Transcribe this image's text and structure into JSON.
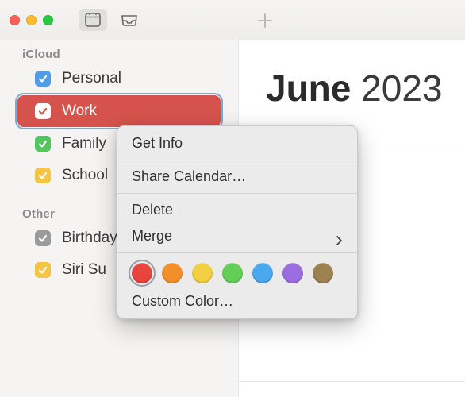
{
  "header": {
    "month": "June",
    "year": "2023"
  },
  "sidebar": {
    "sections": [
      {
        "title": "iCloud",
        "items": [
          {
            "label": "Personal",
            "color": "#4f9de6",
            "selected": false
          },
          {
            "label": "Work",
            "color": "#d5534c",
            "selected": true
          },
          {
            "label": "Family",
            "color": "#54c65e",
            "selected": false
          },
          {
            "label": "School",
            "color": "#f4c542",
            "selected": false
          }
        ]
      },
      {
        "title": "Other",
        "items": [
          {
            "label": "Birthdays",
            "color": "#9b9b9b",
            "selected": false
          },
          {
            "label": "Siri Su",
            "color": "#f4c542",
            "selected": false
          }
        ]
      }
    ]
  },
  "context_menu": {
    "get_info": "Get Info",
    "share": "Share Calendar…",
    "delete": "Delete",
    "merge": "Merge",
    "custom_color": "Custom Color…",
    "colors": [
      {
        "hex": "#e9453f",
        "selected": true
      },
      {
        "hex": "#f38f2b"
      },
      {
        "hex": "#f3cf43"
      },
      {
        "hex": "#63cf57"
      },
      {
        "hex": "#4aa8ee"
      },
      {
        "hex": "#9a6de0"
      },
      {
        "hex": "#9e8150"
      }
    ]
  }
}
